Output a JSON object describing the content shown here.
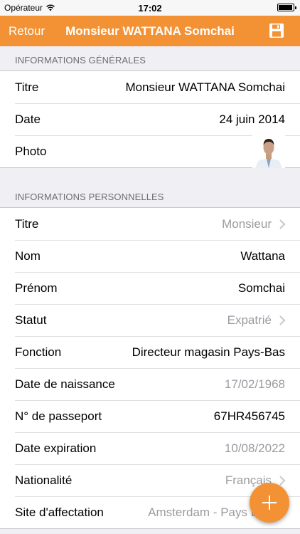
{
  "status_bar": {
    "carrier": "Opérateur",
    "time": "17:02"
  },
  "nav": {
    "back_label": "Retour",
    "title": "Monsieur WATTANA Somchai",
    "save_icon": "save-icon"
  },
  "colors": {
    "accent": "#f39234",
    "muted_text": "#9b9b9f",
    "section_text": "#6d6d72"
  },
  "section_general": {
    "header": "INFORMATIONS GÉNÉRALES",
    "rows": [
      {
        "label": "Titre",
        "value": "Monsieur WATTANA Somchai"
      },
      {
        "label": "Date",
        "value": "24 juin 2014"
      },
      {
        "label": "Photo",
        "value": ""
      }
    ]
  },
  "section_personal": {
    "header": "INFORMATIONS PERSONNELLES",
    "rows": [
      {
        "label": "Titre",
        "value": "Monsieur"
      },
      {
        "label": "Nom",
        "value": "Wattana"
      },
      {
        "label": "Prénom",
        "value": "Somchai"
      },
      {
        "label": "Statut",
        "value": "Expatrié"
      },
      {
        "label": "Fonction",
        "value": "Directeur magasin Pays-Bas"
      },
      {
        "label": "Date de naissance",
        "value": "17/02/1968"
      },
      {
        "label": "N° de passeport",
        "value": "67HR456745"
      },
      {
        "label": "Date expiration",
        "value": "10/08/2022"
      },
      {
        "label": "Nationalité",
        "value": "Français"
      },
      {
        "label": "Site d'affectation",
        "value": "Amsterdam - Pays Bas"
      }
    ]
  },
  "fab": {
    "icon": "plus-icon"
  }
}
